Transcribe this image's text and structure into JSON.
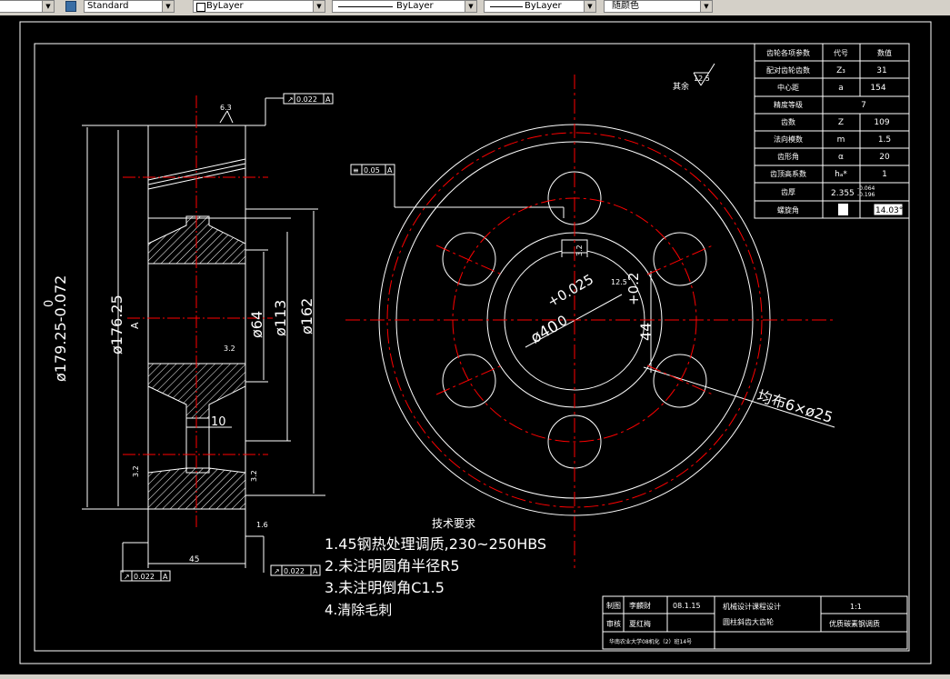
{
  "toolbar": {
    "style_value": "Standard",
    "layer_value": "ByLayer",
    "linetype_value": "ByLayer",
    "lineweight_value": "ByLayer",
    "color_value": "随颜色"
  },
  "params_table": {
    "headers": [
      "齿轮各项参数",
      "代号",
      "数值"
    ],
    "rows": [
      [
        "配对齿轮齿数",
        "Z₃",
        "31"
      ],
      [
        "中心距",
        "a",
        "154"
      ],
      [
        "精度等级",
        "",
        "7"
      ],
      [
        "齿数",
        "Z",
        "109"
      ],
      [
        "法向模数",
        "m",
        "1.5"
      ],
      [
        "齿形角",
        "α",
        "20"
      ],
      [
        "齿顶高系数",
        "hₐ*",
        "1"
      ],
      [
        "齿厚",
        "2.355",
        ""
      ],
      [
        "螺旋角",
        "",
        "14.03°"
      ]
    ],
    "tooth_thickness_upper": "-0.064",
    "tooth_thickness_lower": "-0.196"
  },
  "dims": {
    "outer_dia": "ø179.25-0.072",
    "outer_dia_upper": "0",
    "dia_176": "ø176.25",
    "dia_64": "ø64",
    "dia_113": "ø113",
    "dia_162": "ø162",
    "width_10": "10",
    "width_45": "45",
    "bore_dia": "ø40",
    "bore_tol_upper": "+0.025",
    "bore_tol_lower": "0",
    "key_depth": "44",
    "key_tol": "+0.2",
    "holes": "均布6×ø25",
    "ra_63": "6.3",
    "ra_125": "12.5",
    "ra_32": "3.2",
    "ra_16": "1.6",
    "rest_label": "其余",
    "rest_ra": "12.5",
    "tol_runout": "0.022",
    "tol_sym": "0.05",
    "datum": "A"
  },
  "tech": {
    "title": "技术要求",
    "lines": [
      "1.45钢热处理调质,230~250HBS",
      "2.未注明圆角半径R5",
      "3.未注明倒角C1.5",
      "4.清除毛刺"
    ]
  },
  "title_block": {
    "role1": "制图",
    "name1": "李麟财",
    "date1": "08.1.15",
    "role2": "审核",
    "name2": "夏红梅",
    "course": "机械设计课程设计",
    "part": "圆柱斜齿大齿轮",
    "scale": "1:1",
    "material": "优质碳素钢调质",
    "school": "华南农业大学08机化（2）班14号"
  },
  "colors": {
    "center_line": "#ff0000",
    "drawing": "#ffffff",
    "background": "#000000"
  }
}
